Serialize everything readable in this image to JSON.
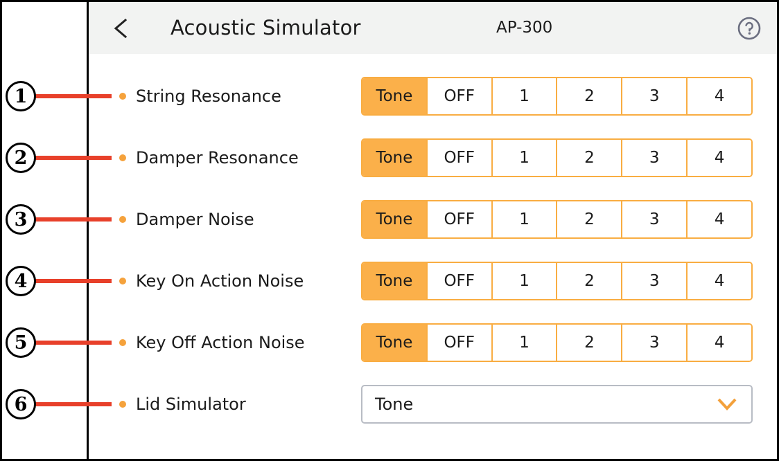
{
  "header": {
    "back_icon": "chevron-left-icon",
    "title": "Acoustic Simulator",
    "model": "AP-300",
    "help_icon": "help-circle-icon"
  },
  "rows": [
    {
      "callout": "1",
      "bullet": "orange-dot-icon",
      "label": "String Resonance",
      "control": "segmented",
      "options": [
        "Tone",
        "OFF",
        "1",
        "2",
        "3",
        "4"
      ],
      "selected": "Tone"
    },
    {
      "callout": "2",
      "bullet": "orange-dot-icon",
      "label": "Damper Resonance",
      "control": "segmented",
      "options": [
        "Tone",
        "OFF",
        "1",
        "2",
        "3",
        "4"
      ],
      "selected": "Tone"
    },
    {
      "callout": "3",
      "bullet": "orange-dot-icon",
      "label": "Damper Noise",
      "control": "segmented",
      "options": [
        "Tone",
        "OFF",
        "1",
        "2",
        "3",
        "4"
      ],
      "selected": "Tone"
    },
    {
      "callout": "4",
      "bullet": "orange-dot-icon",
      "label": "Key On Action Noise",
      "control": "segmented",
      "options": [
        "Tone",
        "OFF",
        "1",
        "2",
        "3",
        "4"
      ],
      "selected": "Tone"
    },
    {
      "callout": "5",
      "bullet": "orange-dot-icon",
      "label": "Key Off Action Noise",
      "control": "segmented",
      "options": [
        "Tone",
        "OFF",
        "1",
        "2",
        "3",
        "4"
      ],
      "selected": "Tone"
    },
    {
      "callout": "6",
      "bullet": "orange-dot-icon",
      "label": "Lid Simulator",
      "control": "dropdown",
      "value": "Tone",
      "chevron_icon": "chevron-down-icon"
    }
  ],
  "colors": {
    "accent_orange": "#fbb04a",
    "border_orange": "#f9ad42",
    "bullet_orange": "#f5a23c",
    "callout_red": "#e8402a",
    "header_band": "#f2f3f2",
    "dropdown_border": "#b8bcc4",
    "help_gray": "#6b6e80",
    "text_dark": "#1b1b1b"
  }
}
